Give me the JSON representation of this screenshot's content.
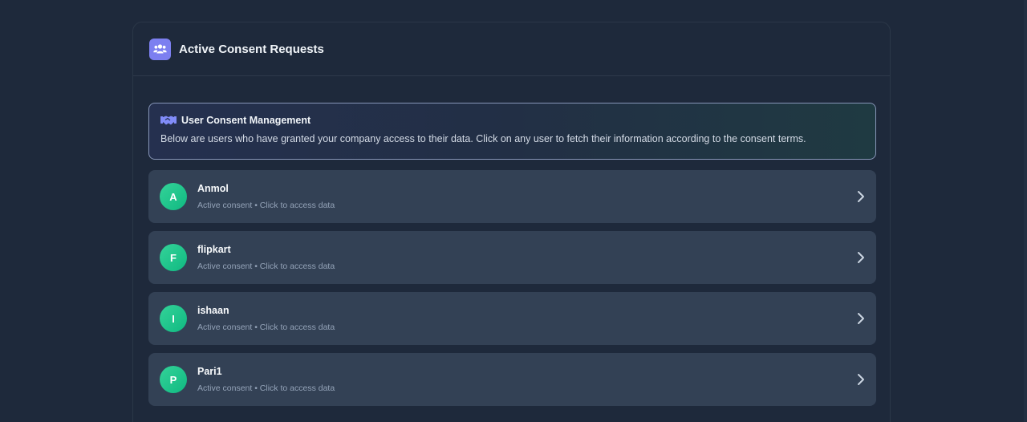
{
  "header": {
    "title": "Active Consent Requests",
    "icon": "users-icon",
    "icon_color": "#7c7ff0"
  },
  "info": {
    "icon": "handshake-icon",
    "title": "User Consent Management",
    "text": "Below are users who have granted your company access to their data. Click on any user to fetch their information according to the consent terms."
  },
  "users": [
    {
      "initial": "A",
      "name": "Anmol",
      "status": "Active consent • Click to access data"
    },
    {
      "initial": "F",
      "name": "flipkart",
      "status": "Active consent • Click to access data"
    },
    {
      "initial": "I",
      "name": "ishaan",
      "status": "Active consent • Click to access data"
    },
    {
      "initial": "P",
      "name": "Pari1",
      "status": "Active consent • Click to access data"
    }
  ],
  "colors": {
    "background": "#1e293b",
    "row": "#334155",
    "avatar": "#10b981",
    "accent": "#7c7ff0"
  }
}
